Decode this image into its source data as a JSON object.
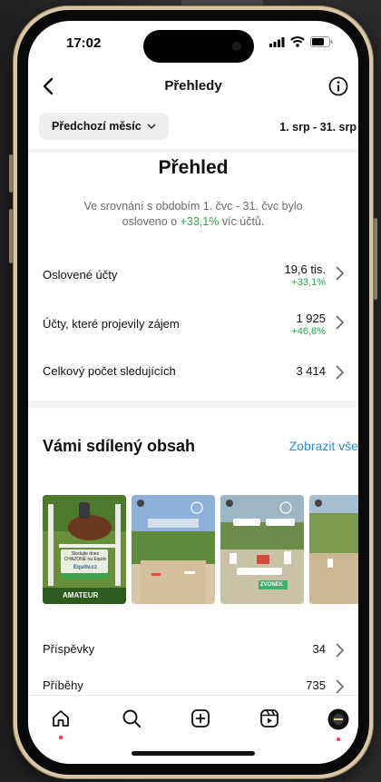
{
  "status": {
    "time": "17:02"
  },
  "nav": {
    "title": "Přehledy",
    "back_icon": "chevron-left-icon",
    "info_icon": "info-circle-icon"
  },
  "filter": {
    "period_label": "Předchozí měsíc",
    "date_range": "1. srp - 31. srp"
  },
  "overview": {
    "title": "Přehled",
    "desc_before": "Ve srovnání s obdobím 1. čvc - 31. čvc bylo osloveno o ",
    "desc_highlight": "+33,1%",
    "desc_after": " víc účtů."
  },
  "metrics": [
    {
      "label": "Oslovené účty",
      "value": "19,6 tis.",
      "change": "+33,1%"
    },
    {
      "label": "Účty, které projevily zájem",
      "value": "1 925",
      "change": "+46,8%"
    },
    {
      "label": "Celkový počet sledujících",
      "value": "3 414",
      "change": ""
    }
  ],
  "shared": {
    "title": "Vámi sdílený obsah",
    "show_all": "Zobrazit vše",
    "thumbnails": [
      {
        "kind": "post",
        "texts": [
          "Sledujte dnes",
          "CHAZONE na Equitv",
          "Equitv.cz",
          "AMATEUR"
        ]
      },
      {
        "kind": "story",
        "texts": []
      },
      {
        "kind": "story",
        "texts": [
          "ZVONEK"
        ]
      },
      {
        "kind": "story",
        "texts": []
      }
    ]
  },
  "counts": [
    {
      "label": "Příspěvky",
      "value": "34"
    },
    {
      "label": "Příběhy",
      "value": "735"
    }
  ],
  "tabbar": {
    "icons": [
      "home-icon",
      "search-icon",
      "create-icon",
      "reels-icon",
      "profile-avatar"
    ]
  },
  "colors": {
    "accent_link": "#2d8fd6",
    "positive": "#2ea44f",
    "notification": "#ff3040"
  }
}
